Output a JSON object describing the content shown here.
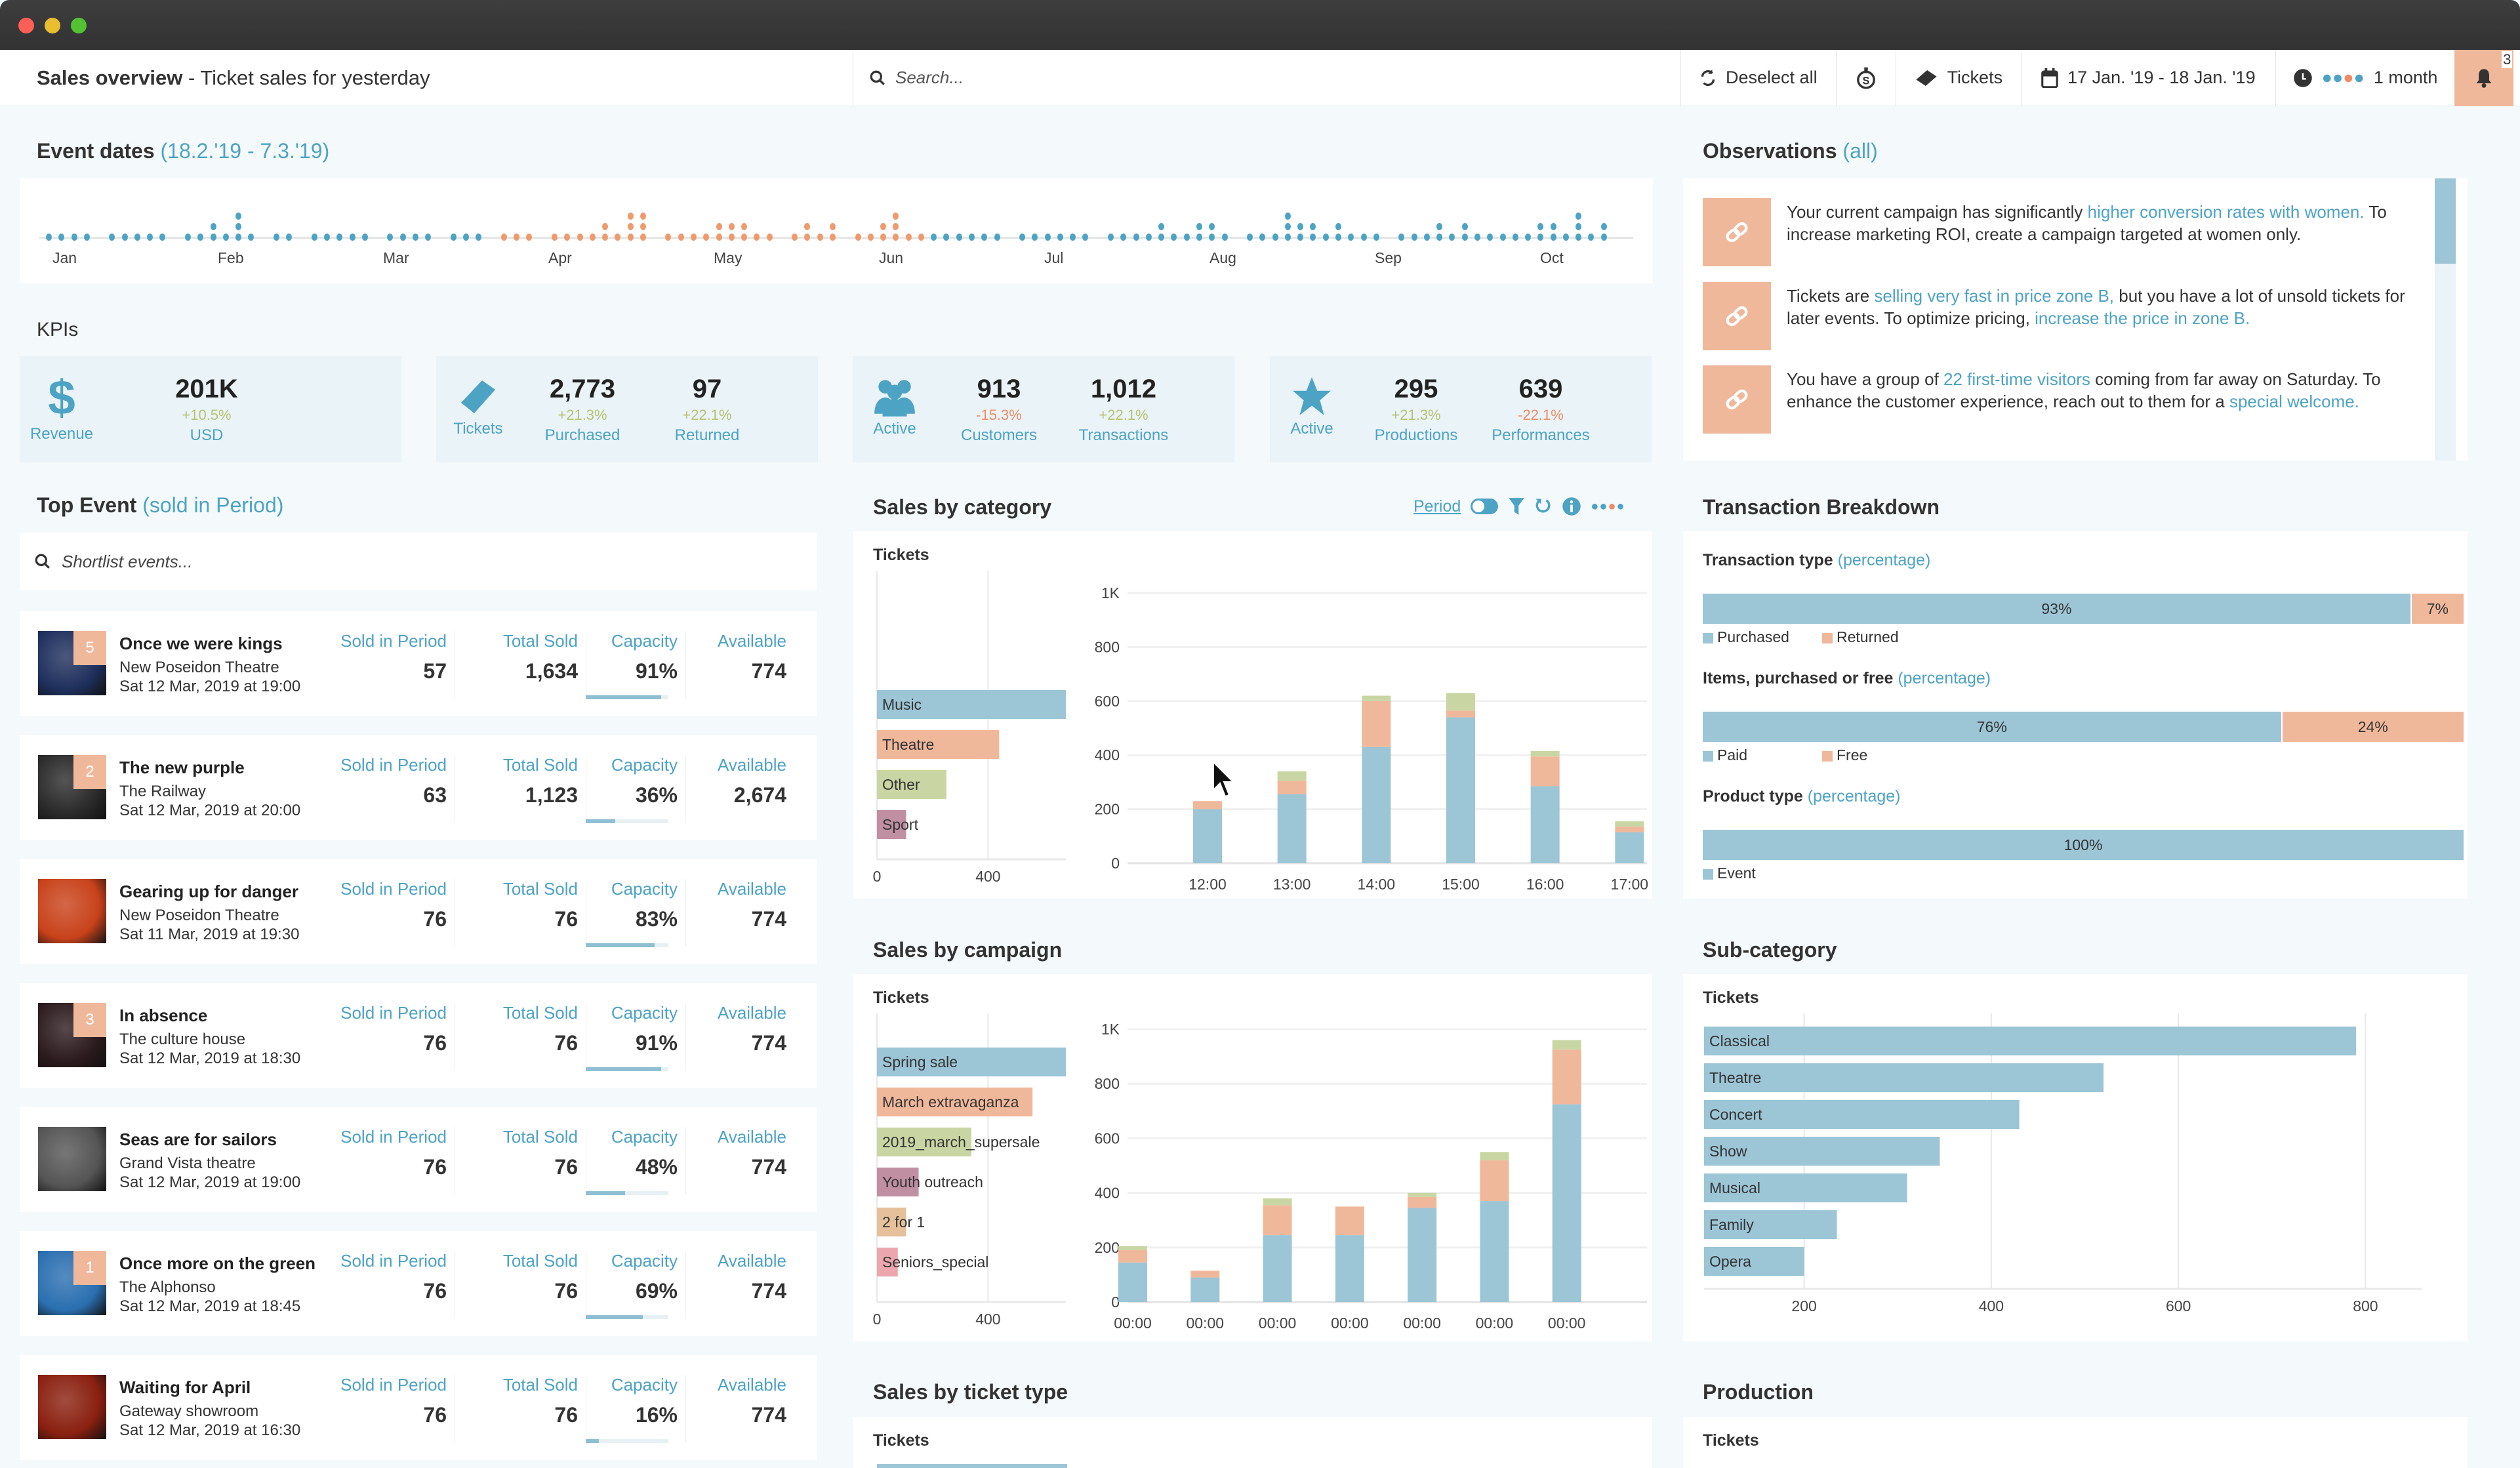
{
  "window": {
    "controls": [
      "close",
      "minimize",
      "maximize"
    ]
  },
  "header": {
    "title_bold": "Sales overview",
    "title_rest": " - Ticket sales for yesterday",
    "search_placeholder": "Search...",
    "deselect_label": "Deselect all",
    "tickets_label": "Tickets",
    "date_range": "17 Jan. '19 - 18 Jan. '19",
    "period_label": "1 month",
    "notification_count": "3"
  },
  "event_dates": {
    "title": "Event dates",
    "range": "(18.2.'19 - 7.3.'19)",
    "months": [
      "Jan",
      "Feb",
      "Mar",
      "Apr",
      "May",
      "Jun",
      "Jul",
      "Aug",
      "Sep",
      "Oct"
    ],
    "highlight_color": "#ef9a6c",
    "base_color": "#4da3c4"
  },
  "kpis": {
    "title": "KPIs",
    "groups": [
      {
        "icon": "dollar-icon",
        "icon_label": "Revenue",
        "items": [
          {
            "value": "201K",
            "change": "+10.5%",
            "trend": "up",
            "label": "USD"
          }
        ]
      },
      {
        "icon": "ticket-icon",
        "icon_label": "Tickets",
        "items": [
          {
            "value": "2,773",
            "change": "+21.3%",
            "trend": "up",
            "label": "Purchased"
          },
          {
            "value": "97",
            "change": "+22.1%",
            "trend": "up",
            "label": "Returned"
          }
        ]
      },
      {
        "icon": "users-icon",
        "icon_label": "Active",
        "items": [
          {
            "value": "913",
            "change": "-15.3%",
            "trend": "down",
            "label": "Customers"
          },
          {
            "value": "1,012",
            "change": "+22.1%",
            "trend": "up",
            "label": "Transactions"
          }
        ]
      },
      {
        "icon": "star-icon",
        "icon_label": "Active",
        "items": [
          {
            "value": "295",
            "change": "+21.3%",
            "trend": "up",
            "label": "Productions"
          },
          {
            "value": "639",
            "change": "-22.1%",
            "trend": "down",
            "label": "Performances"
          }
        ]
      }
    ]
  },
  "observations": {
    "title": "Observations",
    "filter": "(all)",
    "items": [
      {
        "parts": [
          {
            "t": "Your current campaign has significantly "
          },
          {
            "t": "higher conversion rates with women.",
            "link": true
          },
          {
            "t": " To increase marketing ROI, create a campaign targeted at women only."
          }
        ]
      },
      {
        "parts": [
          {
            "t": "Tickets are "
          },
          {
            "t": "selling very fast in price zone B,",
            "link": true
          },
          {
            "t": " but you have a lot of unsold tickets for later events. To optimize pricing, "
          },
          {
            "t": "increase the price in zone B.",
            "link": true
          }
        ]
      },
      {
        "parts": [
          {
            "t": "You have a group of "
          },
          {
            "t": "22 first-time visitors",
            "link": true
          },
          {
            "t": " coming from far away on Saturday. To enhance the customer experience, reach out to them for a "
          },
          {
            "t": "special welcome.",
            "link": true
          }
        ]
      }
    ]
  },
  "top_event": {
    "title": "Top Event",
    "subtitle": "(sold in Period)",
    "search_placeholder": "Shortlist events...",
    "columns": [
      "Sold in Period",
      "Total Sold",
      "Capacity",
      "Available"
    ],
    "events": [
      {
        "rank": "5",
        "name": "Once we were kings",
        "venue": "New Poseidon Theatre",
        "date": "Sat 12 Mar, 2019 at 19:00",
        "sold_period": "57",
        "total_sold": "1,634",
        "capacity": "91%",
        "capacity_frac": 0.91,
        "available": "774",
        "thumb": "#1e2f5c"
      },
      {
        "rank": "2",
        "name": "The new purple",
        "venue": "The Railway",
        "date": "Sat 12 Mar, 2019 at 20:00",
        "sold_period": "63",
        "total_sold": "1,123",
        "capacity": "36%",
        "capacity_frac": 0.36,
        "available": "2,674",
        "thumb": "#2a2a2a"
      },
      {
        "rank": "",
        "name": "Gearing up for danger",
        "venue": "New Poseidon Theatre",
        "date": "Sat 11 Mar, 2019 at 19:30",
        "sold_period": "76",
        "total_sold": "76",
        "capacity": "83%",
        "capacity_frac": 0.83,
        "available": "774",
        "thumb": "#c8421a"
      },
      {
        "rank": "3",
        "name": "In absence",
        "venue": "The culture house",
        "date": "Sat 12 Mar, 2019 at 18:30",
        "sold_period": "76",
        "total_sold": "76",
        "capacity": "91%",
        "capacity_frac": 0.91,
        "available": "774",
        "thumb": "#2b1a1e"
      },
      {
        "rank": "",
        "name": "Seas are for sailors",
        "venue": "Grand Vista theatre",
        "date": "Sat 12 Mar, 2019 at 19:00",
        "sold_period": "76",
        "total_sold": "76",
        "capacity": "48%",
        "capacity_frac": 0.48,
        "available": "774",
        "thumb": "#555555"
      },
      {
        "rank": "1",
        "name": "Once more on the green",
        "venue": "The Alphonso",
        "date": "Sat 12 Mar, 2019 at 18:45",
        "sold_period": "76",
        "total_sold": "76",
        "capacity": "69%",
        "capacity_frac": 0.69,
        "available": "774",
        "thumb": "#2a6fb0"
      },
      {
        "rank": "",
        "name": "Waiting for April",
        "venue": "Gateway showroom",
        "date": "Sat 12 Mar, 2019 at 16:30",
        "sold_period": "76",
        "total_sold": "76",
        "capacity": "16%",
        "capacity_frac": 0.16,
        "available": "774",
        "thumb": "#8a2010"
      }
    ]
  },
  "sales_by_category": {
    "title": "Sales by category",
    "period_link": "Period",
    "tools": [
      "toggle-icon",
      "filter-icon",
      "reset-icon",
      "info-icon",
      "more-icon"
    ]
  },
  "sales_by_campaign": {
    "title": "Sales by campaign"
  },
  "sales_by_ticket_type": {
    "title": "Sales by ticket type",
    "ylabel": "Tickets"
  },
  "transaction_breakdown": {
    "title": "Transaction Breakdown",
    "rows": [
      {
        "label": "Transaction type",
        "tag": "(percentage)",
        "segments": [
          {
            "name": "Purchased",
            "pct": 93,
            "text": "93%"
          },
          {
            "name": "Returned",
            "pct": 7,
            "text": "7%"
          }
        ]
      },
      {
        "label": "Items, purchased or free",
        "tag": "(percentage)",
        "segments": [
          {
            "name": "Paid",
            "pct": 76,
            "text": "76%"
          },
          {
            "name": "Free",
            "pct": 24,
            "text": "24%"
          }
        ]
      },
      {
        "label": "Product type",
        "tag": "(percentage)",
        "segments": [
          {
            "name": "Event",
            "pct": 100,
            "text": "100%"
          }
        ]
      }
    ]
  },
  "sub_category": {
    "title": "Sub-category"
  },
  "production": {
    "title": "Production",
    "ylabel": "Tickets"
  },
  "colors": {
    "blue": "#9cc5d6",
    "orange": "#f0b89b",
    "green": "#c9d6a3",
    "purple": "#c08fa2",
    "tan": "#e6c09a",
    "pink": "#eba6ae",
    "accent": "#4da3c4",
    "up": "#b7c46e",
    "down": "#ef8c64"
  },
  "chart_data": [
    {
      "id": "category_totals",
      "type": "bar",
      "orientation": "horizontal",
      "ylabel": "Tickets",
      "categories": [
        "Music",
        "Theatre",
        "Other",
        "Sport"
      ],
      "values": [
        680,
        440,
        250,
        105
      ],
      "xticks": [
        "0",
        "400"
      ],
      "xlim": [
        0,
        680
      ]
    },
    {
      "id": "category_by_hour",
      "type": "bar",
      "stacked": true,
      "categories": [
        "12:00",
        "13:00",
        "14:00",
        "15:00",
        "16:00",
        "17:00"
      ],
      "series": [
        {
          "name": "Music",
          "values": [
            200,
            255,
            430,
            540,
            285,
            115
          ]
        },
        {
          "name": "Theatre",
          "values": [
            30,
            50,
            170,
            25,
            110,
            20
          ]
        },
        {
          "name": "Other",
          "values": [
            0,
            35,
            20,
            65,
            20,
            20
          ]
        }
      ],
      "yticks": [
        "0",
        "200",
        "400",
        "600",
        "800",
        "1K"
      ],
      "ylim": [
        0,
        1000
      ]
    },
    {
      "id": "campaign_totals",
      "type": "bar",
      "orientation": "horizontal",
      "ylabel": "Tickets",
      "categories": [
        "Spring sale",
        "March extravaganza",
        "2019_march_supersale",
        "Youth outreach",
        "2 for 1",
        "Seniors_special"
      ],
      "values": [
        680,
        560,
        340,
        150,
        105,
        75
      ],
      "xticks": [
        "0",
        "400"
      ],
      "xlim": [
        0,
        680
      ]
    },
    {
      "id": "campaign_by_time",
      "type": "bar",
      "stacked": true,
      "categories": [
        "00:00",
        "00:00",
        "00:00",
        "00:00",
        "00:00",
        "00:00",
        "00:00"
      ],
      "series": [
        {
          "name": "Spring sale",
          "values": [
            145,
            90,
            245,
            245,
            345,
            370,
            725
          ]
        },
        {
          "name": "March extravaganza",
          "values": [
            45,
            25,
            110,
            105,
            40,
            150,
            200
          ]
        },
        {
          "name": "2019_march_supersale",
          "values": [
            15,
            0,
            25,
            0,
            15,
            30,
            35
          ]
        }
      ],
      "yticks": [
        "0",
        "200",
        "400",
        "600",
        "800",
        "1K"
      ],
      "ylim": [
        0,
        1000
      ]
    },
    {
      "id": "sub_category",
      "type": "bar",
      "orientation": "horizontal",
      "ylabel": "Tickets",
      "categories": [
        "Classical",
        "Theatre",
        "Concert",
        "Show",
        "Musical",
        "Family",
        "Opera"
      ],
      "values": [
        790,
        520,
        430,
        345,
        310,
        235,
        200
      ],
      "xticks": [
        "200",
        "400",
        "600",
        "800"
      ],
      "xlim": [
        93,
        860
      ]
    }
  ]
}
